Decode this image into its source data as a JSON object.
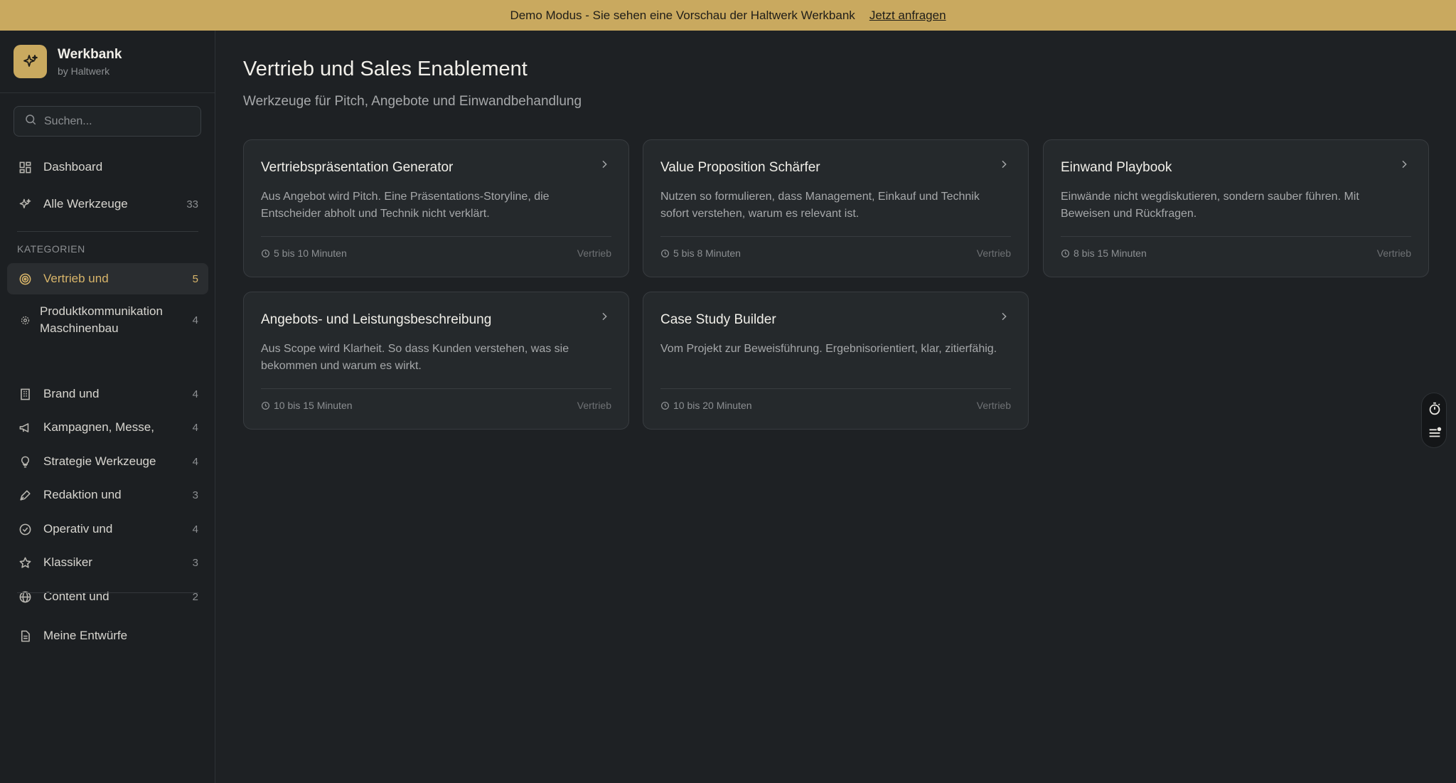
{
  "banner": {
    "text": "Demo Modus - Sie sehen eine Vorschau der Haltwerk Werkbank",
    "link": "Jetzt anfragen"
  },
  "brand": {
    "title": "Werkbank",
    "subtitle": "by Haltwerk"
  },
  "search": {
    "placeholder": "Suchen..."
  },
  "nav": {
    "dashboard": "Dashboard",
    "all_tools": {
      "label": "Alle Werkzeuge",
      "count": "33"
    },
    "section_label": "KATEGORIEN",
    "categories": [
      {
        "label": "Vertrieb und",
        "count": "5",
        "icon": "target-icon"
      },
      {
        "label": "Produktkommunikation Maschinenbau",
        "count": "4",
        "icon": "cog-icon"
      },
      {
        "label": "Brand und",
        "count": "4",
        "icon": "building-icon"
      },
      {
        "label": "Kampagnen, Messe,",
        "count": "4",
        "icon": "megaphone-icon"
      },
      {
        "label": "Strategie Werkzeuge",
        "count": "4",
        "icon": "lightbulb-icon"
      },
      {
        "label": "Redaktion und",
        "count": "3",
        "icon": "pen-icon"
      },
      {
        "label": "Operativ und",
        "count": "4",
        "icon": "check-circle-icon"
      },
      {
        "label": "Klassiker",
        "count": "3",
        "icon": "star-icon"
      },
      {
        "label": "Content und",
        "count": "2",
        "icon": "globe-icon"
      }
    ],
    "drafts": "Meine Entwürfe"
  },
  "page": {
    "title": "Vertrieb und Sales Enablement",
    "subtitle": "Werkzeuge für Pitch, Angebote und Einwandbehandlung"
  },
  "cards": [
    {
      "title": "Vertriebspräsentation Generator",
      "desc": "Aus Angebot wird Pitch. Eine Präsentations-Storyline, die Entscheider abholt und Technik nicht verklärt.",
      "time": "5 bis 10 Minuten",
      "category": "Vertrieb"
    },
    {
      "title": "Value Proposition Schärfer",
      "desc": "Nutzen so formulieren, dass Management, Einkauf und Technik sofort verstehen, warum es relevant ist.",
      "time": "5 bis 8 Minuten",
      "category": "Vertrieb"
    },
    {
      "title": "Einwand Playbook",
      "desc": "Einwände nicht wegdiskutieren, sondern sauber führen. Mit Beweisen und Rückfragen.",
      "time": "8 bis 15 Minuten",
      "category": "Vertrieb"
    },
    {
      "title": "Angebots- und Leistungsbeschreibung",
      "desc": "Aus Scope wird Klarheit. So dass Kunden verstehen, was sie bekommen und warum es wirkt.",
      "time": "10 bis 15 Minuten",
      "category": "Vertrieb"
    },
    {
      "title": "Case Study Builder",
      "desc": "Vom Projekt zur Beweisführung. Ergebnisorientiert, klar, zitierfähig.",
      "time": "10 bis 20 Minuten",
      "category": "Vertrieb"
    }
  ],
  "colors": {
    "accent": "#c9a95f",
    "background": "#1e2124",
    "card": "#25292c",
    "active_text": "#d8b56a"
  }
}
